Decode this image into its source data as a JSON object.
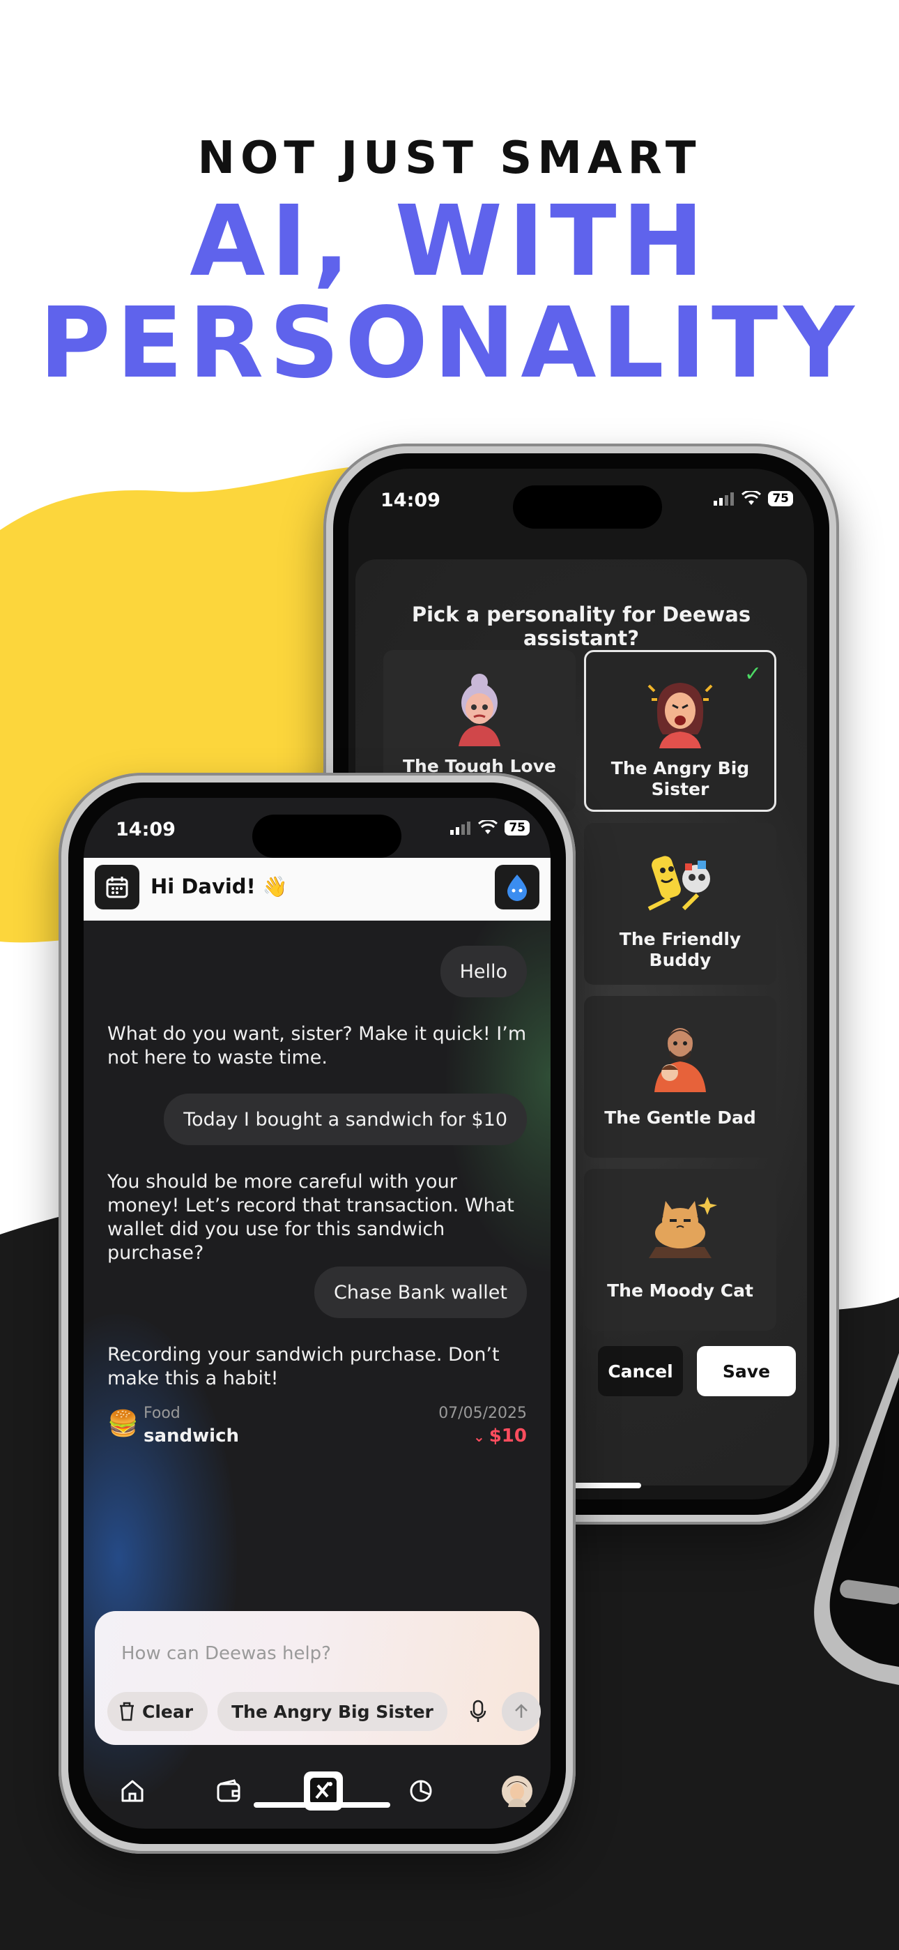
{
  "headline": {
    "line1": "NOT JUST SMART",
    "line2": "AI, WITH",
    "line3": "PERSONALITY"
  },
  "colors": {
    "accent": "#5f63ec",
    "yellow_blob": "#fcd63c",
    "dark_blob": "#1a1a1a",
    "amount_negative": "#ff4d5e",
    "check": "#4cd964"
  },
  "back_phone": {
    "status": {
      "time": "14:09",
      "battery": "75"
    },
    "sheet_title": "Pick a personality for Deewas assistant?",
    "personalities": [
      {
        "name": "The Tough Love Mom",
        "icon": "grandma-avatar-icon",
        "selected": false
      },
      {
        "name": "The Angry Big Sister",
        "icon": "angry-sister-avatar-icon",
        "selected": true
      },
      {
        "name": "The Friendly Buddy",
        "icon": "friendly-buddy-avatar-icon",
        "selected": false
      },
      {
        "name": "The Gentle Dad",
        "icon": "gentle-dad-avatar-icon",
        "selected": false
      },
      {
        "name": "The Moody Cat",
        "icon": "moody-cat-avatar-icon",
        "selected": false
      }
    ],
    "cancel_label": "Cancel",
    "save_label": "Save"
  },
  "front_phone": {
    "status": {
      "time": "14:09",
      "battery": "75"
    },
    "greeting": "Hi David! 👋",
    "messages": {
      "user1": "Hello",
      "bot1": "What do you want, sister? Make it quick! I’m not here to waste time.",
      "user2": "Today I bought a sandwich for $10",
      "bot2": "You should be more careful with your money! Let’s record that transaction. What wallet did you use for this sandwich purchase?",
      "user3": "Chase Bank wallet",
      "bot3": "Recording your sandwich purchase. Don’t make this a habit!"
    },
    "transaction": {
      "emoji": "🍔",
      "category": "Food",
      "item": "sandwich",
      "date": "07/05/2025",
      "amount": "$10"
    },
    "composer": {
      "placeholder": "How can Deewas help?",
      "clear_label": "Clear",
      "persona_label": "The Angry Big Sister"
    },
    "tabs": [
      "home-icon",
      "wallet-icon",
      "ai-assistant-icon",
      "chart-icon",
      "profile-avatar"
    ]
  }
}
